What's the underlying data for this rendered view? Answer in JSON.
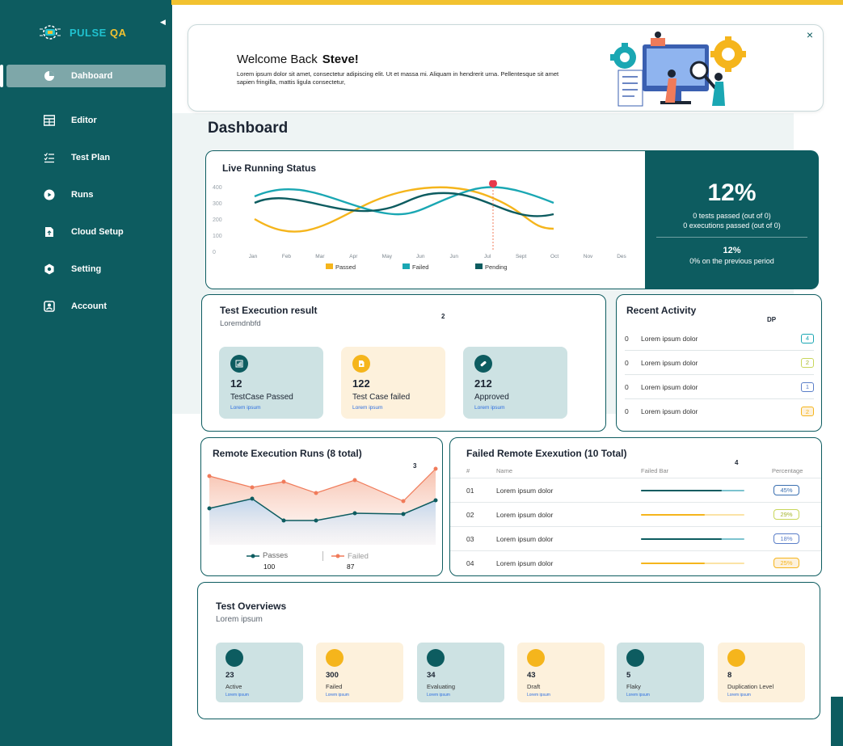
{
  "brand": {
    "name_a": "PULSE",
    "name_b": "QA"
  },
  "sidebar": {
    "items": [
      {
        "label": "Dahboard",
        "icon": "pie-icon",
        "active": true
      },
      {
        "label": "Editor",
        "icon": "table-icon"
      },
      {
        "label": "Test Plan",
        "icon": "checklist-icon"
      },
      {
        "label": "Runs",
        "icon": "play-icon"
      },
      {
        "label": "Cloud Setup",
        "icon": "file-upload-icon"
      },
      {
        "label": "Setting",
        "icon": "gear-icon"
      },
      {
        "label": "Account",
        "icon": "user-icon"
      }
    ]
  },
  "welcome": {
    "greeting": "Welcome Back",
    "name": "Steve!",
    "text": "Lorem ipsum dolor sit amet, consectetur adipiscing elit. Ut et massa mi. Aliquam in hendrerit urna. Pellentesque sit amet sapien fringilla, mattis ligula consectetur,",
    "close": "×"
  },
  "page_title": "Dashboard",
  "live": {
    "title": "Live Running Status",
    "legend": [
      "Passed",
      "Failed",
      "Pending"
    ]
  },
  "stats": {
    "big": "12%",
    "line1": "0 tests passed (out of 0)",
    "line2": "0 executions passed (out of 0)",
    "mid": "12%",
    "note": "0% on the previous period"
  },
  "exec": {
    "title": "Test Execution result",
    "subtitle": "Loremdnbfd",
    "marker": "2",
    "cards": [
      {
        "value": "12",
        "label": "TestCase Passed",
        "link": "Lorem ipsum"
      },
      {
        "value": "122",
        "label": "Test Case failed",
        "link": "Lorem ipsum"
      },
      {
        "value": "212",
        "label": "Approved",
        "link": "Lorem ipsum"
      }
    ]
  },
  "activity": {
    "title": "Recent Activity",
    "col": "DP",
    "rows": [
      {
        "idx": "0",
        "text": "Lorem ipsum dolor",
        "badge": "4"
      },
      {
        "idx": "0",
        "text": "Lorem ipsum dolor",
        "badge": "2"
      },
      {
        "idx": "0",
        "text": "Lorem ipsum dolor",
        "badge": "1"
      },
      {
        "idx": "0",
        "text": "Lorem ipsum dolor",
        "badge": "2"
      }
    ]
  },
  "remote": {
    "title": "Remote Execution Runs (8 total)",
    "marker": "3",
    "legend_passes": "Passes",
    "legend_failed": "Failed",
    "passes_value": "100",
    "failed_value": "87"
  },
  "failed": {
    "title": "Failed Remote Exexution (10 Total)",
    "marker": "4",
    "headers": [
      "#",
      "Name",
      "Failed Bar",
      "Percentage"
    ],
    "rows": [
      {
        "idx": "01",
        "name": "Lorem ipsum dolor",
        "pct": "45%",
        "fill": 0.78
      },
      {
        "idx": "02",
        "name": "Lorem ipsum dolor",
        "pct": "29%",
        "fill": 0.62
      },
      {
        "idx": "03",
        "name": "Lorem ipsum dolor",
        "pct": "18%",
        "fill": 0.78
      },
      {
        "idx": "04",
        "name": "Lorem ipsum dolor",
        "pct": "25%",
        "fill": 0.62
      }
    ]
  },
  "overview": {
    "title": "Test Overviews",
    "subtitle": "Lorem ipsum",
    "tiles": [
      {
        "value": "23",
        "label": "Active",
        "link": "Lorem ipsum"
      },
      {
        "value": "300",
        "label": "Failed",
        "link": "Lorem ipsum"
      },
      {
        "value": "34",
        "label": "Evaluating",
        "link": "Lorem ipsum"
      },
      {
        "value": "43",
        "label": "Draft",
        "link": "Lorem ipsum"
      },
      {
        "value": "5",
        "label": "Flaky",
        "link": "Lorem ipsum"
      },
      {
        "value": "8",
        "label": "Duplication Level",
        "link": "Lorem ipsum"
      }
    ]
  },
  "chart_data": [
    {
      "type": "line",
      "x": [
        "Jan",
        "Feb",
        "Mar",
        "Apr",
        "May",
        "Jun",
        "Jun",
        "Jul",
        "Sept",
        "Oct",
        "Nov",
        "Des"
      ],
      "ylim": [
        0,
        400
      ],
      "yticks": [
        "400",
        "300",
        "200",
        "100",
        "0"
      ],
      "series": [
        {
          "name": "Passed",
          "color": "#f5b51c"
        },
        {
          "name": "Failed",
          "color": "#1aa7b3"
        },
        {
          "name": "Pending",
          "color": "#0d5c60"
        }
      ]
    },
    {
      "type": "area",
      "series": [
        {
          "name": "Failed",
          "color": "#f07b5a"
        },
        {
          "name": "Passes",
          "color": "#0d5c60"
        }
      ]
    }
  ],
  "colors": {
    "teal": "#0d5c60",
    "yellow": "#f2c230",
    "cyan": "#1aa7b3"
  }
}
